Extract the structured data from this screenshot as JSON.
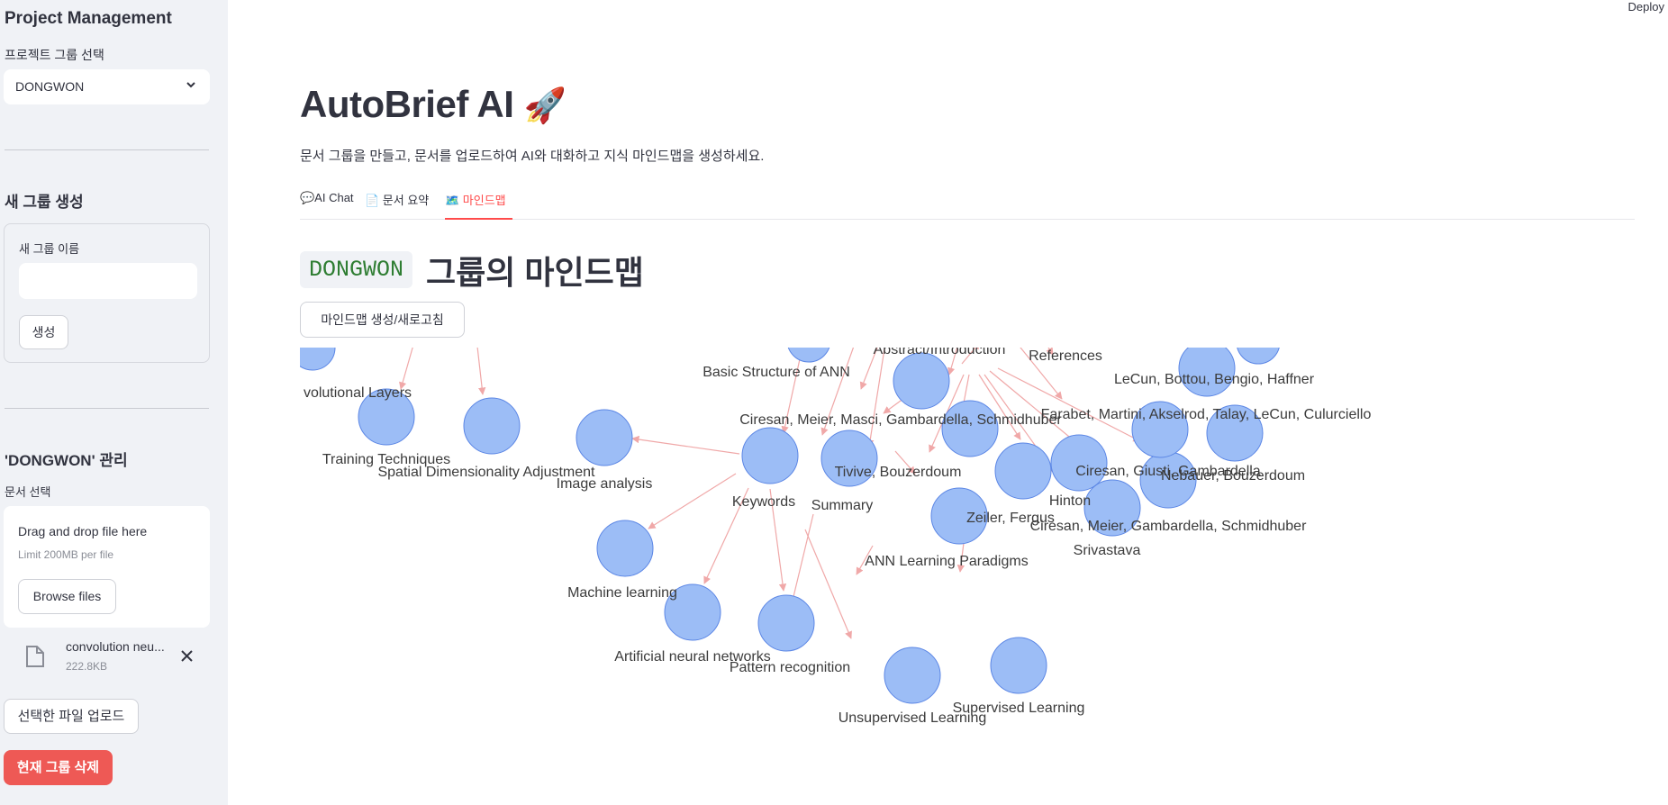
{
  "sidebar": {
    "title": "Project Management",
    "group_select_label": "프로젝트 그룹 선택",
    "group_selected": "DONGWON",
    "new_group_heading": "새 그룹 생성",
    "new_group_name_label": "새 그룹 이름",
    "new_group_name_value": "",
    "create_button": "생성",
    "manage_heading": "'DONGWON' 관리",
    "document_select_label": "문서 선택",
    "uploader": {
      "main_text": "Drag and drop file here",
      "limit_text": "Limit 200MB per file",
      "browse_button": "Browse files"
    },
    "uploaded_file": {
      "name": "convolution neu...",
      "size": "222.8KB"
    },
    "upload_button": "선택한 파일 업로드",
    "delete_button": "현재 그룹 삭제"
  },
  "header": {
    "deploy": "Deploy"
  },
  "main": {
    "title": "AutoBrief AI",
    "title_emoji": "🚀",
    "subtitle": "문서 그룹을 만들고, 문서를 업로드하여 AI와 대화하고 지식 마인드맵을 생성하세요.",
    "tabs": [
      {
        "label": "💬AI Chat",
        "active": false
      },
      {
        "label": "📄 문서 요약",
        "active": false
      },
      {
        "label": "🗺️ 마인드맵",
        "active": true
      }
    ],
    "mindmap_group_code": "DONGWON",
    "mindmap_heading": "그룹의 마인드맵",
    "mindmap_button": "마인드맵 생성/새로고침"
  },
  "mindmap": {
    "node_color": "#9cbdf6",
    "node_border": "#5b86e5",
    "edge_color": "#f0a8a8",
    "labels": [
      "volutional Layers",
      "Training Techniques",
      "Spatial Dimensionality Adjustment",
      "Image analysis",
      "Keywords",
      "Summary",
      "Basic Structure of ANN",
      "Abstract/Introduction",
      "References",
      "Ciresan, Meier, Masci, Gambardella, Schmidhuber",
      "Tivive, Bouzerdoum",
      "ANN Learning Paradigms",
      "Zeiler, Fergus",
      "Hinton",
      "Ciresan, Giusti, Gambardella",
      "Ciresan, Meier, Gambardella, Schmidhuber",
      "Srivastava",
      "Nebauer, Bouzerdoum",
      "Farabet, Martini, Akselrod, Talay, LeCun, Culurciello",
      "LeCun, Bottou, Bengio, Haffner",
      "Machine learning",
      "Artificial neural networks",
      "Pattern recognition",
      "Unsupervised Learning",
      "Supervised Learning"
    ]
  }
}
